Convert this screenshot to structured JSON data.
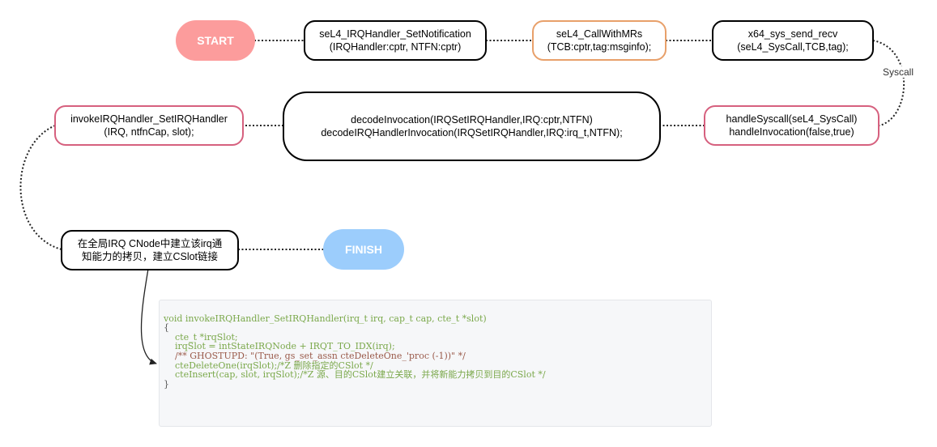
{
  "start_label": "START",
  "finish_label": "FINISH",
  "colors": {
    "start_fill": "#fc9c9c",
    "finish_fill": "#9ccdfc",
    "orange_border": "#e8a06a",
    "pink_border": "#d6607e",
    "black_border": "#000000",
    "code_background": "#f6f7f9",
    "code_keyword": "#7aa84a",
    "code_comment": "#9a5a4a"
  },
  "nodes": {
    "set_notification": {
      "line1": "seL4_IRQHandler_SetNotification",
      "line2": "(IRQHandler:cptr, NTFN:cptr)"
    },
    "call_with_mrs": {
      "line1": "seL4_CallWithMRs",
      "line2": "(TCB:cptr,tag:msginfo);"
    },
    "send_recv": {
      "line1": "x64_sys_send_recv",
      "line2": "(seL4_SysCall,TCB,tag);"
    },
    "handle_syscall": {
      "line1": "handleSyscall(seL4_SysCall)",
      "line2": "handleInvocation(false,true)"
    },
    "decode_invocation": {
      "line1": "decodeInvocation(IRQSetIRQHandler,IRQ:cptr,NTFN)",
      "line2": "decodeIRQHandlerInvocation(IRQSetIRQHandler,IRQ:irq_t,NTFN);"
    },
    "invoke_handler": {
      "line1": "invokeIRQHandler_SetIRQHandler",
      "line2": "(IRQ, ntfnCap, slot);"
    },
    "build_copy": {
      "line1": "在全局IRQ CNode中建立该irq通",
      "line2": "知能力的拷贝，建立CSlot链接"
    }
  },
  "edge_labels": {
    "syscall": "Syscall"
  },
  "code": {
    "lines": [
      "void invokeIRQHandler_SetIRQHandler(irq_t irq, cap_t cap, cte_t *slot)",
      "{",
      "    cte_t *irqSlot;",
      "    irqSlot = intStateIRQNode + IRQT_TO_IDX(irq);",
      "    /** GHOSTUPD: \"(True, gs_set_assn cteDeleteOne_'proc (-1))\" */",
      "    cteDeleteOne(irqSlot);/*Z 删除指定的CSlot */",
      "    cteInsert(cap, slot, irqSlot);/*Z 源、目的CSlot建立关联，并将新能力拷贝到目的CSlot */",
      "}"
    ]
  }
}
